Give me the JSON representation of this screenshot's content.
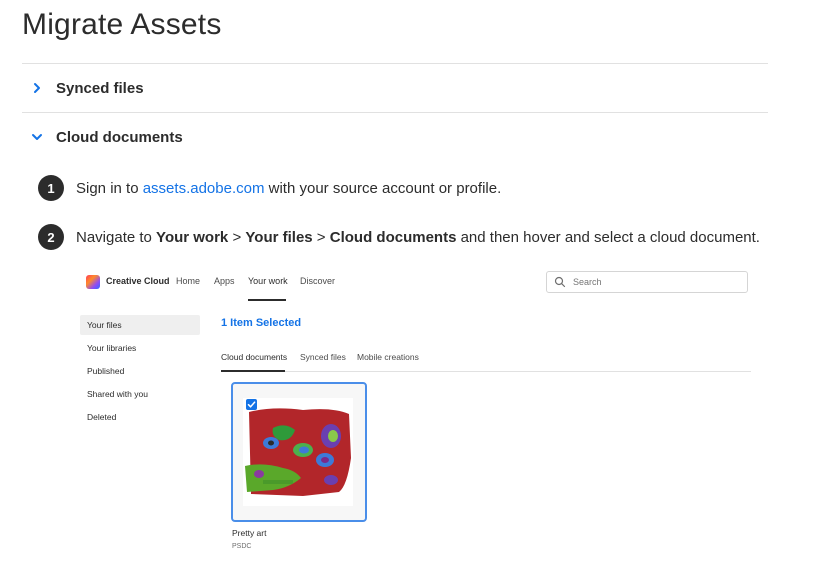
{
  "page": {
    "title": "Migrate Assets"
  },
  "accordions": [
    {
      "label": "Synced files",
      "expanded": false,
      "icon": "chevron-right-icon"
    },
    {
      "label": "Cloud documents",
      "expanded": true,
      "icon": "chevron-down-icon"
    }
  ],
  "steps": [
    {
      "number": "1",
      "pre": "Sign in to ",
      "link": "assets.adobe.com",
      "post": " with your source account or profile."
    },
    {
      "number": "2",
      "pre": "Navigate to ",
      "bold1": "Your work",
      "sep1": " > ",
      "bold2": "Your files",
      "sep2": " > ",
      "bold3": "Cloud documents",
      "post": " and then hover and select a cloud document."
    }
  ],
  "screenshot": {
    "brand": "Creative Cloud",
    "nav": [
      "Home",
      "Apps",
      "Your work",
      "Discover"
    ],
    "active_nav": "Your work",
    "search_placeholder": "Search",
    "sidebar": [
      "Your files",
      "Your libraries",
      "Published",
      "Shared with you",
      "Deleted"
    ],
    "active_sidebar": "Your files",
    "selection_status": "1 Item Selected",
    "tabs": [
      "Cloud documents",
      "Synced files",
      "Mobile creations"
    ],
    "active_tab": "Cloud documents",
    "file": {
      "name": "Pretty art",
      "type": "PSDC",
      "selected": true
    }
  },
  "colors": {
    "link": "#1473e6",
    "selection_border": "#4a8ee9",
    "step_badge": "#2c2c2c"
  }
}
